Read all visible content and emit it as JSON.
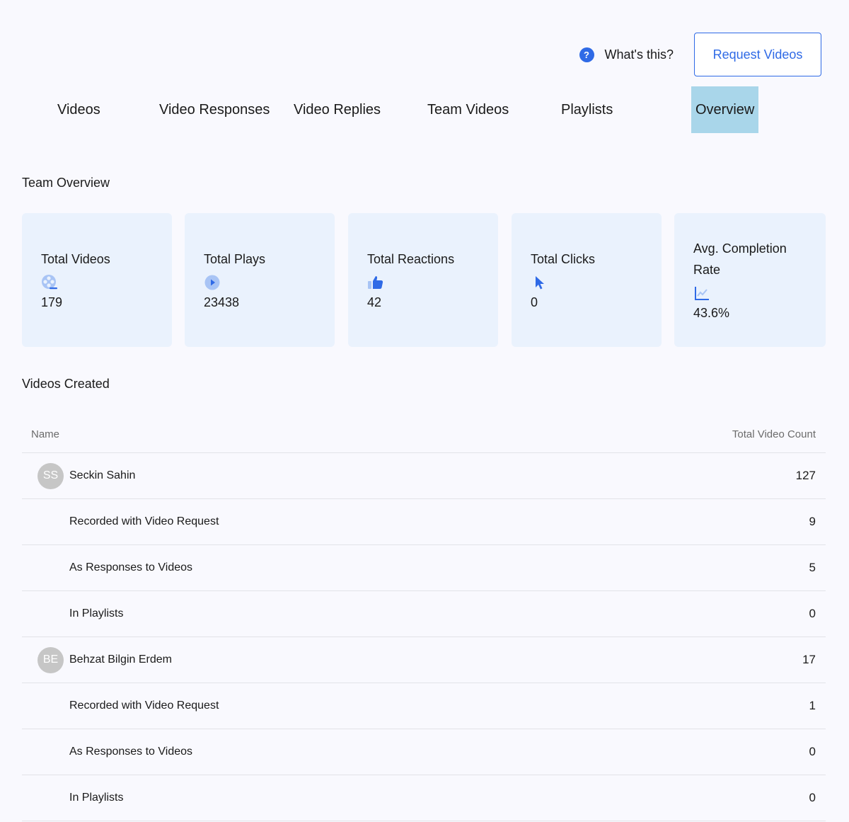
{
  "header": {
    "help_label": "What's this?",
    "request_button": "Request Videos"
  },
  "tabs": [
    {
      "label": "Videos"
    },
    {
      "label": "Video Responses"
    },
    {
      "label": "Video Replies"
    },
    {
      "label": "Team Videos"
    },
    {
      "label": "Playlists"
    },
    {
      "label": "Overview",
      "active": true
    }
  ],
  "overview": {
    "title": "Team Overview",
    "cards": [
      {
        "label": "Total Videos",
        "icon": "film-reel-icon",
        "value": "179"
      },
      {
        "label": "Total Plays",
        "icon": "play-circle-icon",
        "value": "23438"
      },
      {
        "label": "Total Reactions",
        "icon": "thumbs-up-icon",
        "value": "42"
      },
      {
        "label": "Total Clicks",
        "icon": "cursor-icon",
        "value": "0"
      },
      {
        "label": "Avg. Completion Rate",
        "icon": "line-chart-icon",
        "value": "43.6%"
      }
    ]
  },
  "videos_created": {
    "title": "Videos Created",
    "columns": [
      "Name",
      "Total Video Count"
    ],
    "rows": [
      {
        "type": "user",
        "initials": "SS",
        "name": "Seckin Sahin",
        "count": "127"
      },
      {
        "type": "sub",
        "name": "Recorded with Video Request",
        "count": "9"
      },
      {
        "type": "sub",
        "name": "As Responses to Videos",
        "count": "5"
      },
      {
        "type": "sub",
        "name": "In Playlists",
        "count": "0"
      },
      {
        "type": "user",
        "initials": "BE",
        "name": "Behzat Bilgin Erdem",
        "count": "17"
      },
      {
        "type": "sub",
        "name": "Recorded with Video Request",
        "count": "1"
      },
      {
        "type": "sub",
        "name": "As Responses to Videos",
        "count": "0"
      },
      {
        "type": "sub",
        "name": "In Playlists",
        "count": "0"
      }
    ]
  },
  "colors": {
    "accent": "#2f6ae6",
    "active_tab": "#a9d6ea",
    "card_bg": "#eaf2fd",
    "avatar_bg": "#c6c6c6"
  }
}
